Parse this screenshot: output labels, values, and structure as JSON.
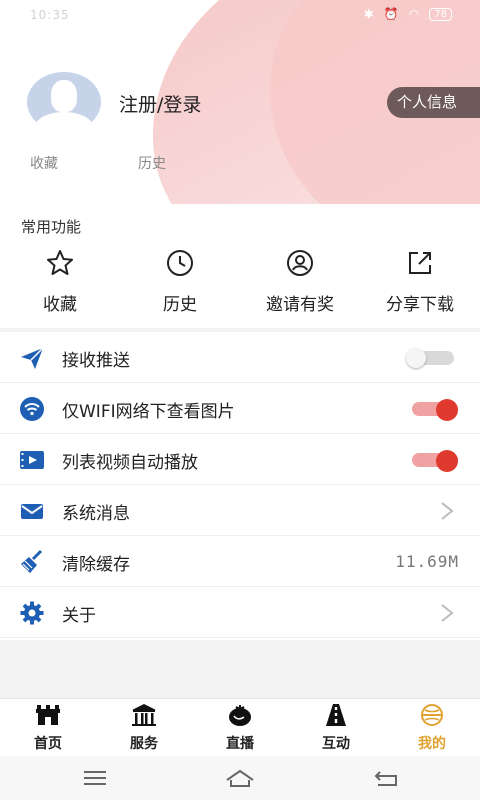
{
  "status_bar": {
    "time": "10:35",
    "battery": "78"
  },
  "profile": {
    "login_label": "注册/登录",
    "profile_button": "个人信息",
    "links": [
      "收藏",
      "历史"
    ]
  },
  "common_functions": {
    "title": "常用功能",
    "items": [
      {
        "label": "收藏",
        "icon": "star-icon"
      },
      {
        "label": "历史",
        "icon": "clock-icon"
      },
      {
        "label": "邀请有奖",
        "icon": "person-icon"
      },
      {
        "label": "分享下载",
        "icon": "share-icon"
      }
    ]
  },
  "settings": {
    "items": [
      {
        "label": "接收推送",
        "icon": "send-icon",
        "control": "toggle",
        "enabled": false
      },
      {
        "label": "仅WIFI网络下查看图片",
        "icon": "wifi-icon",
        "control": "toggle",
        "enabled": true
      },
      {
        "label": "列表视频自动播放",
        "icon": "video-icon",
        "control": "toggle",
        "enabled": true
      },
      {
        "label": "系统消息",
        "icon": "mail-icon",
        "control": "chevron"
      },
      {
        "label": "清除缓存",
        "icon": "broom-icon",
        "control": "value",
        "value": "11.69M"
      },
      {
        "label": "关于",
        "icon": "gear-icon",
        "control": "chevron"
      }
    ]
  },
  "tabbar": {
    "tabs": [
      {
        "label": "首页",
        "icon": "home-icon",
        "active": false
      },
      {
        "label": "服务",
        "icon": "service-icon",
        "active": false
      },
      {
        "label": "直播",
        "icon": "live-icon",
        "active": false
      },
      {
        "label": "互动",
        "icon": "interact-icon",
        "active": false
      },
      {
        "label": "我的",
        "icon": "mine-icon",
        "active": true
      }
    ]
  },
  "colors": {
    "accent": "#e03a2e",
    "active_tab": "#e0a232",
    "icon_blue": "#1f5fb3"
  }
}
